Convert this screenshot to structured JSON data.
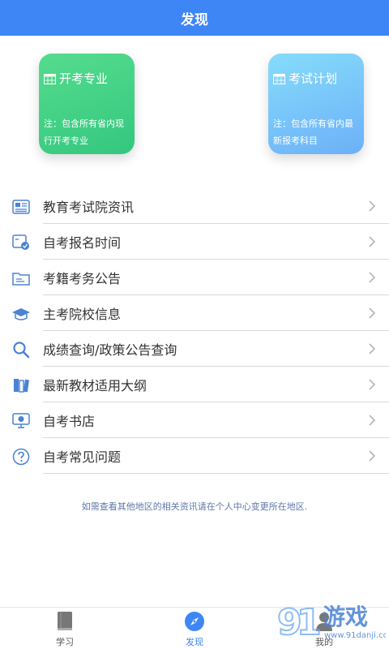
{
  "header": {
    "title": "发现"
  },
  "cards": [
    {
      "title": "开考专业",
      "note": "注：包含所有省内现行开考专业",
      "icon": "calendar-icon"
    },
    {
      "title": "考试计划",
      "note": "注：包含所有省内最新报考科目",
      "icon": "calendar-icon"
    }
  ],
  "list": [
    {
      "label": "教育考试院资讯",
      "icon": "news-icon"
    },
    {
      "label": "自考报名时间",
      "icon": "signup-time-icon"
    },
    {
      "label": "考籍考务公告",
      "icon": "folder-icon"
    },
    {
      "label": "主考院校信息",
      "icon": "graduation-cap-icon"
    },
    {
      "label": "成绩查询/政策公告查询",
      "icon": "search-icon"
    },
    {
      "label": "最新教材适用大纲",
      "icon": "books-icon"
    },
    {
      "label": "自考书店",
      "icon": "monitor-icon"
    },
    {
      "label": "自考常见问题",
      "icon": "question-icon"
    }
  ],
  "tip": "如需查看其他地区的相关资讯请在个人中心变更所在地区.",
  "tabbar": {
    "study": "学习",
    "discover": "发现",
    "mine": "我的"
  },
  "colors": {
    "primary": "#3e86f5",
    "card_green": "#3fcf84",
    "card_blue": "#78c4fa",
    "icon_blue": "#4a82d4",
    "chevron": "#b5b5b5"
  }
}
